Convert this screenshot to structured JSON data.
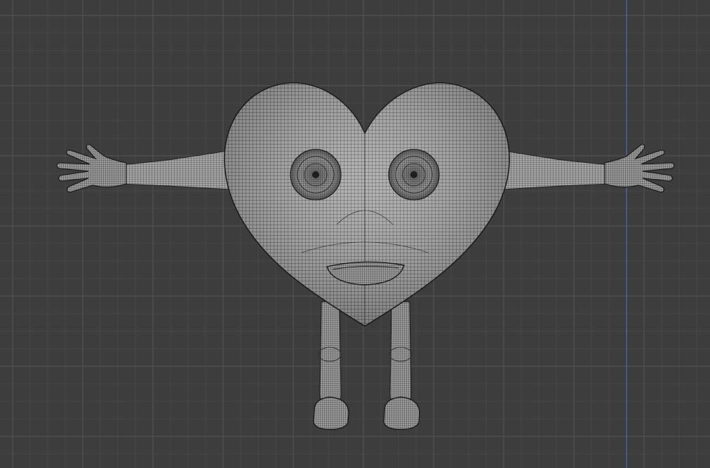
{
  "app": {
    "name": "3D Viewport"
  },
  "viewport": {
    "view": "front-orthographic",
    "shading": "wireframe-overlay",
    "background_color": "#3d3d3d",
    "grid_minor_color": "#484848",
    "grid_major_color": "#555555",
    "axis_line_color": "#4a78c8",
    "mesh_fill_color": "#a8a8a8",
    "mesh_wire_color": "#2e2e2e",
    "mesh_shadow_color": "#6f6f6f"
  },
  "model": {
    "object": "heart-character",
    "parts": [
      "heart-body",
      "left-eye",
      "right-eye",
      "mouth",
      "left-arm",
      "right-arm",
      "left-hand",
      "right-hand",
      "left-leg",
      "right-leg",
      "left-foot",
      "right-foot"
    ]
  }
}
